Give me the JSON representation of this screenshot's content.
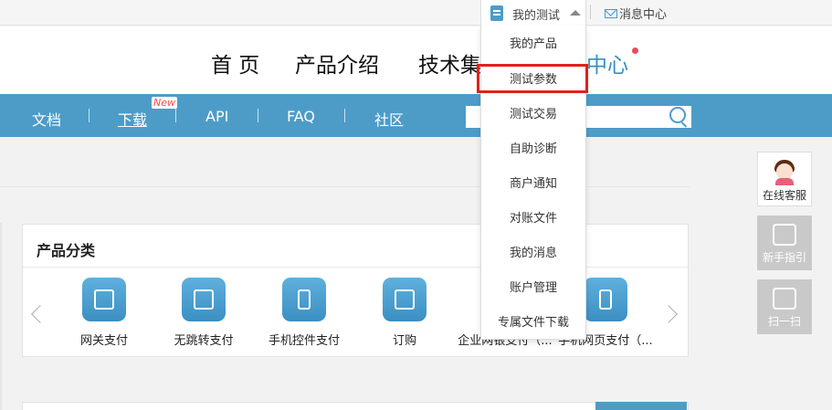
{
  "topbar": {
    "account_menu_label": "我的测试",
    "message_center_label": "消息中心"
  },
  "main_nav": {
    "home": "首 页",
    "product": "产品介绍",
    "tech": "技术集",
    "service": "中心"
  },
  "subnav": {
    "items": [
      "文档",
      "下载",
      "API",
      "FAQ",
      "社区"
    ],
    "new_badge": "New"
  },
  "dropdown": {
    "items": [
      "我的产品",
      "测试参数",
      "测试交易",
      "自助诊断",
      "商户通知",
      "对账文件",
      "我的消息",
      "账户管理",
      "专属文件下载"
    ],
    "highlighted": "测试参数"
  },
  "category_panel": {
    "title": "产品分类",
    "products": [
      "网关支付",
      "无跳转支付",
      "手机控件支付",
      "订购",
      "企业网银支付（...",
      "手机网页支付（..."
    ]
  },
  "side_tools": {
    "online_service": "在线客服",
    "guide": "新手指引",
    "scan": "扫一扫"
  },
  "colors": {
    "accent_blue": "#4d9cc8",
    "highlight_red": "#e0211b",
    "badge_red": "#ff4a4a"
  }
}
